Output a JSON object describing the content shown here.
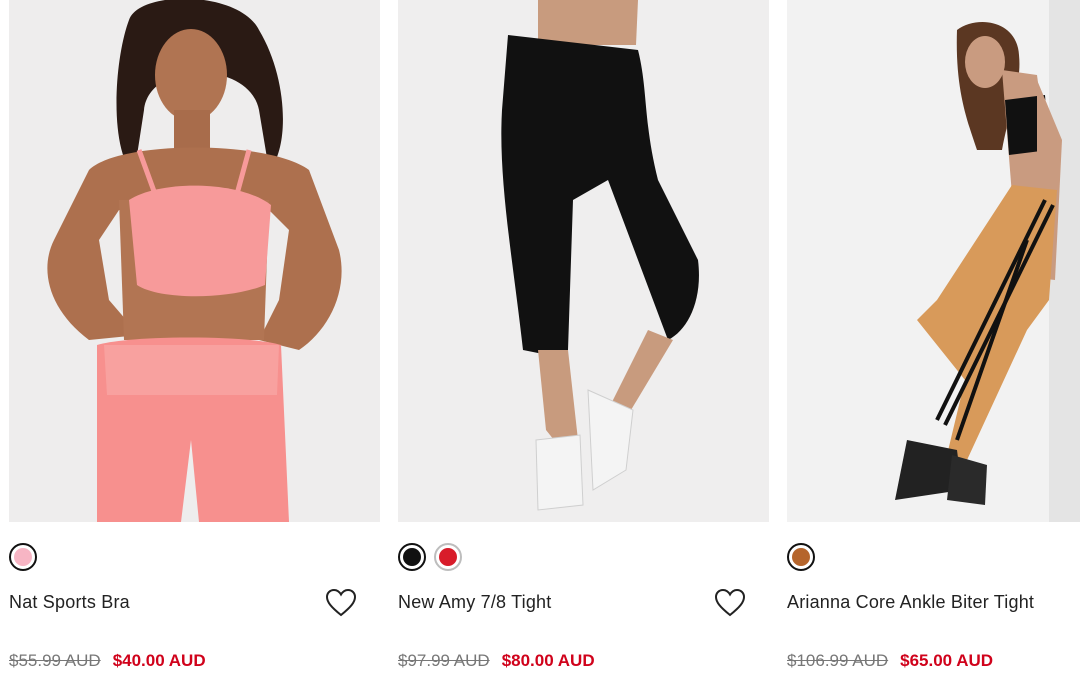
{
  "colors": {
    "sale": "#d0021b",
    "text": "#222222",
    "strike": "#777777"
  },
  "products": [
    {
      "name": "Nat Sports Bra",
      "swatches": [
        {
          "color": "#f7b5c4",
          "name": "pink",
          "selected": true
        }
      ],
      "old_price": "$55.99 AUD",
      "sale_price": "$40.00 AUD",
      "wishlist_icon": "heart-outline-icon"
    },
    {
      "name": "New Amy 7/8 Tight",
      "swatches": [
        {
          "color": "#111111",
          "name": "black",
          "selected": true
        },
        {
          "color": "#d81c2a",
          "name": "red",
          "selected": false
        }
      ],
      "old_price": "$97.99 AUD",
      "sale_price": "$80.00 AUD",
      "wishlist_icon": "heart-outline-icon"
    },
    {
      "name": "Arianna Core Ankle Biter Tight",
      "swatches": [
        {
          "color": "#b5652c",
          "name": "tan",
          "selected": true
        }
      ],
      "old_price": "$106.99 AUD",
      "sale_price": "$65.00 AUD"
    }
  ]
}
